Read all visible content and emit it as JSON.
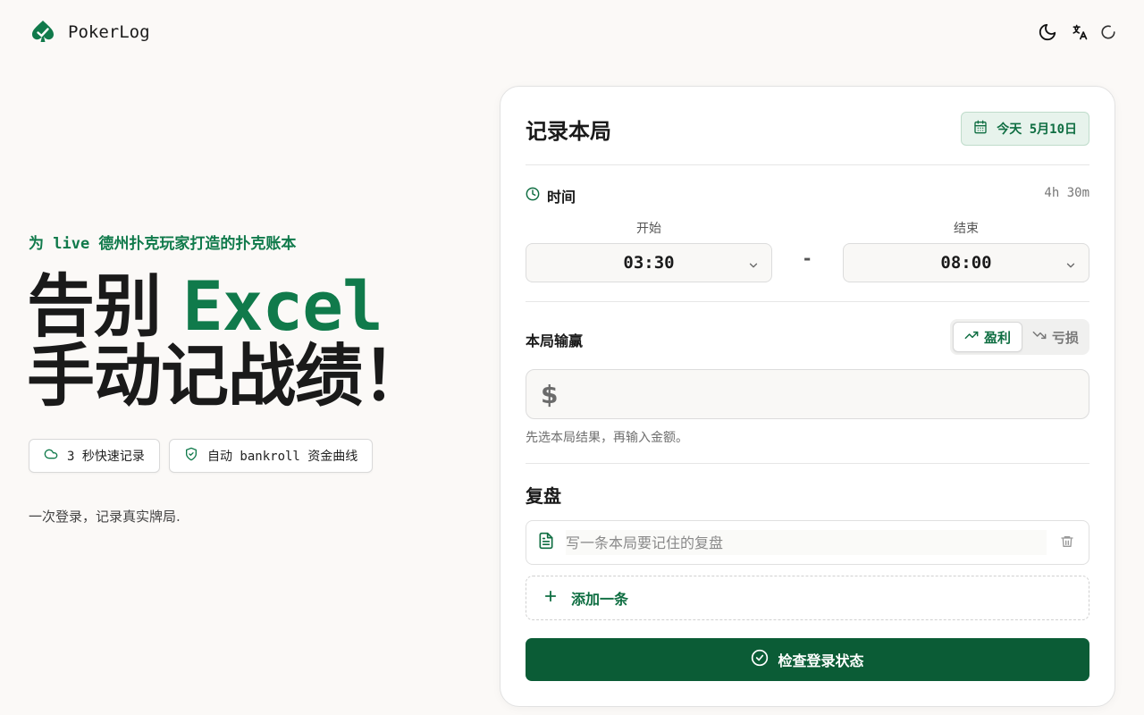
{
  "app": {
    "name": "PokerLog"
  },
  "header": {
    "icons": [
      "theme-toggle-icon",
      "translate-icon",
      "loading-spinner-icon"
    ]
  },
  "hero": {
    "tagline": "为 live 德州扑克玩家打造的扑克账本",
    "headline_part1": "告别",
    "headline_accent": "Excel",
    "headline_line2": "手动记战绩！",
    "chips": [
      {
        "label": "3 秒快速记录",
        "icon": "cloud-icon"
      },
      {
        "label": "自动 bankroll 资金曲线",
        "icon": "shield-check-icon"
      }
    ],
    "subtext": "一次登录，记录真实牌局."
  },
  "card": {
    "title": "记录本局",
    "date_label": "今天 5月10日",
    "time": {
      "label": "时间",
      "duration": "4h 30m",
      "start_caption": "开始",
      "start_value": "03:30",
      "end_caption": "结束",
      "end_value": "08:00",
      "separator": "-"
    },
    "result": {
      "label": "本局输赢",
      "profit_label": "盈利",
      "loss_label": "亏损",
      "selected": "profit",
      "currency_symbol": "$",
      "amount_value": "",
      "hint": "先选本局结果，再输入金额。"
    },
    "review": {
      "title": "复盘",
      "note_placeholder": "写一条本局要记住的复盘",
      "note_value": "",
      "add_label": "添加一条"
    },
    "primary_button_label": "检查登录状态"
  },
  "colors": {
    "accent": "#107a4b",
    "primary_button": "#0b5c36",
    "background": "#fbf9f7",
    "badge_bg": "#e7f3ec"
  }
}
